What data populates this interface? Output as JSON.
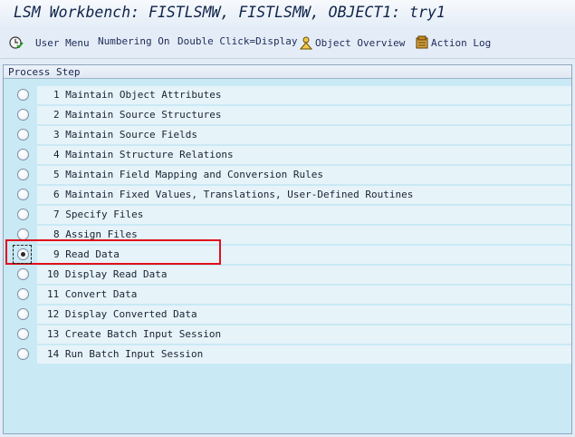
{
  "window": {
    "title": "LSM Workbench: FISTLSMW, FISTLSMW, OBJECT1: try1"
  },
  "toolbar": {
    "items": [
      {
        "label": "User Menu",
        "icon": "clock-check-icon"
      },
      {
        "label": "Numbering On"
      },
      {
        "label": "Double Click=Display"
      },
      {
        "label": "Object Overview",
        "icon": "person-icon"
      },
      {
        "label": "Action Log",
        "icon": "log-icon"
      }
    ]
  },
  "process": {
    "header": "Process Step",
    "selected_step": 9,
    "steps": [
      {
        "num": "1",
        "label": "Maintain Object Attributes"
      },
      {
        "num": "2",
        "label": "Maintain Source Structures"
      },
      {
        "num": "3",
        "label": "Maintain Source Fields"
      },
      {
        "num": "4",
        "label": "Maintain Structure Relations"
      },
      {
        "num": "5",
        "label": "Maintain Field Mapping and Conversion Rules"
      },
      {
        "num": "6",
        "label": "Maintain Fixed Values, Translations, User-Defined Routines"
      },
      {
        "num": "7",
        "label": "Specify Files"
      },
      {
        "num": "8",
        "label": "Assign Files"
      },
      {
        "num": "9",
        "label": "Read Data"
      },
      {
        "num": "10",
        "label": "Display Read Data"
      },
      {
        "num": "11",
        "label": "Convert Data"
      },
      {
        "num": "12",
        "label": "Display Converted Data"
      },
      {
        "num": "13",
        "label": "Create Batch Input Session"
      },
      {
        "num": "14",
        "label": "Run Batch Input Session"
      }
    ]
  },
  "colors": {
    "highlight_border": "#e0101c",
    "panel_background": "#c9e9f5"
  }
}
